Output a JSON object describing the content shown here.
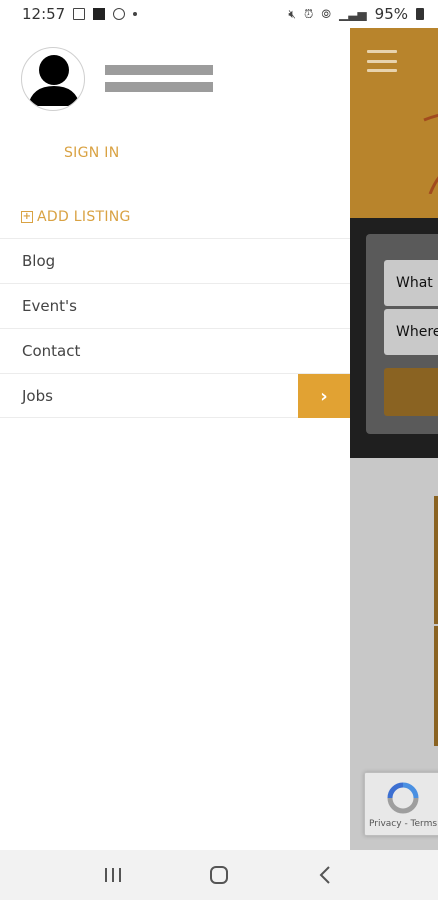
{
  "status_bar": {
    "time": "12:57",
    "battery": "95%",
    "left_icons": [
      "image-icon",
      "square-app-icon",
      "whatsapp-icon",
      "dot-icon"
    ],
    "right_icons": [
      "mute-icon",
      "alarm-icon",
      "wifi-icon",
      "signal-icon",
      "battery-icon"
    ]
  },
  "drawer": {
    "sign_in": "SIGN IN",
    "add_listing": "ADD LISTING",
    "menu_items": [
      {
        "label": "Blog"
      },
      {
        "label": "Event's"
      },
      {
        "label": "Contact"
      },
      {
        "label": "Jobs",
        "has_arrow": true
      }
    ]
  },
  "background_app": {
    "search_what": "What",
    "search_where": "Where",
    "recaptcha_text": "Privacy - Terms"
  },
  "colors": {
    "accent": "#d9a243",
    "arrow_bg": "#e1a233",
    "header_bg": "#b8842c"
  },
  "nav_bar": {
    "buttons": [
      "recent-apps-icon",
      "home-icon",
      "back-icon"
    ]
  }
}
